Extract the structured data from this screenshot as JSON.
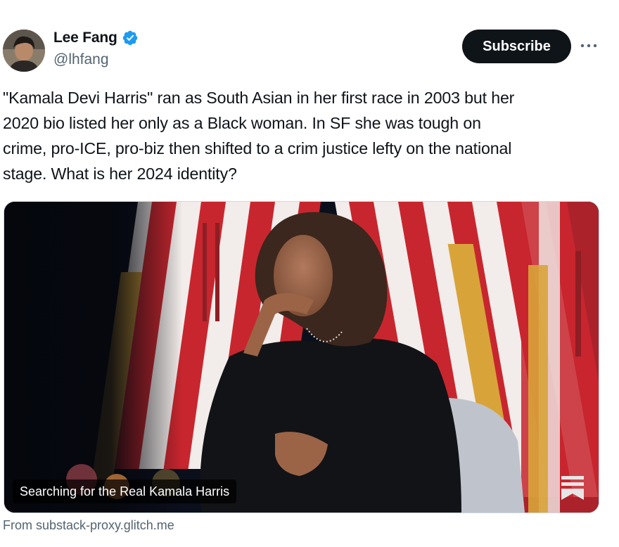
{
  "author": {
    "display_name": "Lee Fang",
    "handle": "@lhfang",
    "verified": true,
    "verified_color": "#1d9bf0"
  },
  "actions": {
    "subscribe_label": "Subscribe",
    "more_icon": "more-horizontal-icon"
  },
  "tweet": {
    "text": "\"Kamala Devi Harris\" ran as South Asian in her first race in 2003 but her\n2020 bio listed her only as a Black woman. In SF she was tough on\ncrime, pro-ICE, pro-biz then shifted to a crim justice lefty on the national\nstage. What is her 2024 identity?"
  },
  "card": {
    "title": "Searching for the Real Kamala Harris",
    "source": "From substack-proxy.glitch.me",
    "badge_icon": "substack-icon"
  },
  "colors": {
    "text": "#0f1419",
    "secondary": "#536471",
    "button_bg": "#0f1419"
  }
}
